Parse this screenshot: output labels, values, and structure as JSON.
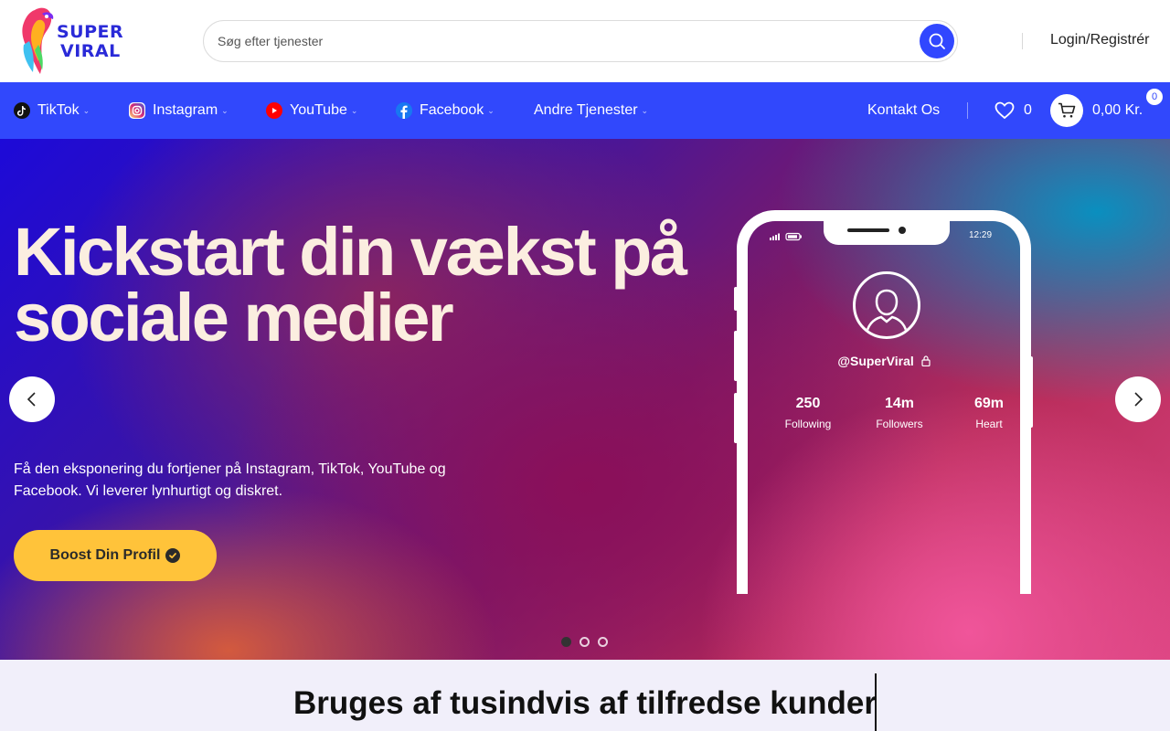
{
  "header": {
    "logo_line1": "SUPER",
    "logo_line2": "VIRAL",
    "search_placeholder": "Søg efter tjenester",
    "login_label": "Login/Registrér"
  },
  "nav": {
    "items": [
      {
        "label": "TikTok",
        "icon": "tiktok-icon"
      },
      {
        "label": "Instagram",
        "icon": "instagram-icon"
      },
      {
        "label": "YouTube",
        "icon": "youtube-icon"
      },
      {
        "label": "Facebook",
        "icon": "facebook-icon"
      },
      {
        "label": "Andre Tjenester",
        "icon": ""
      }
    ],
    "contact_label": "Kontakt Os",
    "wishlist_count": "0",
    "cart_total": "0,00 Kr.",
    "cart_count": "0"
  },
  "hero": {
    "title": "Kickstart din vækst på sociale medier",
    "subtitle": "Få den eksponering du fortjener på Instagram, TikTok, YouTube og Facebook. Vi leverer lynhurtigt og diskret.",
    "cta_label": "Boost Din Profil",
    "phone": {
      "time": "12:29",
      "handle": "@SuperViral",
      "stats": [
        {
          "value": "250",
          "label": "Following"
        },
        {
          "value": "14m",
          "label": "Followers"
        },
        {
          "value": "69m",
          "label": "Heart"
        }
      ]
    },
    "slide_count": 3,
    "active_slide": 1
  },
  "section": {
    "title": "Bruges af tusindvis af tilfredse kunder"
  },
  "colors": {
    "brand_blue": "#3148fc",
    "cta_yellow": "#ffc33a",
    "hero_title": "#fbeee0"
  }
}
